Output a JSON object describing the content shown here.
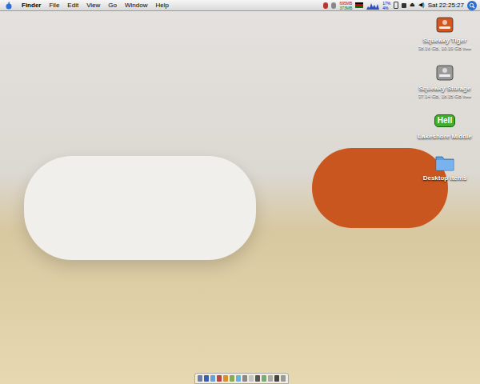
{
  "menu_bar": {
    "app": "Finder",
    "menus": [
      "File",
      "Edit",
      "View",
      "Go",
      "Window",
      "Help"
    ],
    "status": {
      "memory": [
        "695MB",
        "373MB"
      ],
      "cpu": [
        "17%",
        "4%"
      ],
      "clock": "Sat 22:25:27"
    }
  },
  "desktop_icons": [
    {
      "label": "Squeaky Tiger",
      "detail": "38.16 GB, 10.19 GB free",
      "kind": "drive",
      "color": "#d2561e"
    },
    {
      "label": "Squeaky Storage",
      "detail": "37.14 GB, 18.15 GB free",
      "kind": "drive",
      "color": "#9a9a9a"
    },
    {
      "label": "Lakeshore Middle",
      "badge": "Hell",
      "kind": "bubble",
      "color": "#3fae2a"
    },
    {
      "label": "Desktop Items",
      "kind": "folder",
      "color": "#5aa0e6"
    }
  ]
}
